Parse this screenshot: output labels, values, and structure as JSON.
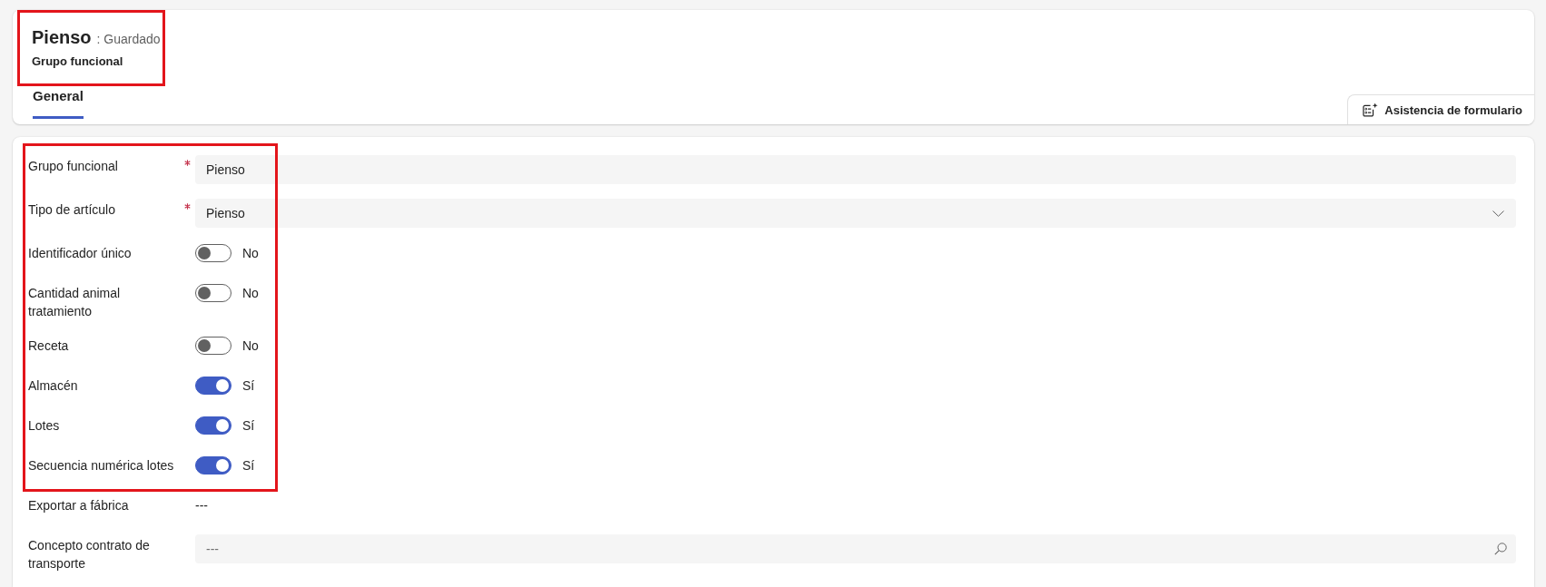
{
  "header": {
    "title": "Pienso",
    "status": ": Guardado",
    "entity": "Grupo funcional",
    "highlighted": true
  },
  "tabs": [
    {
      "label": "General",
      "selected": true
    }
  ],
  "form_assist_button": {
    "label": "Asistencia de formulario"
  },
  "field_groups": [
    {
      "highlighted": true,
      "fields": [
        {
          "kind": "text",
          "label": "Grupo funcional",
          "required": true,
          "value": "Pienso"
        },
        {
          "kind": "dropdown",
          "label": "Tipo de artículo",
          "required": true,
          "value": "Pienso"
        },
        {
          "kind": "toggle",
          "label": "Identificador único",
          "required": false,
          "on": false,
          "value": "No"
        },
        {
          "kind": "toggle",
          "label": "Cantidad animal tratamiento",
          "required": false,
          "on": false,
          "value": "No"
        },
        {
          "kind": "toggle",
          "label": "Receta",
          "required": false,
          "on": false,
          "value": "No"
        },
        {
          "kind": "toggle",
          "label": "Almacén",
          "required": false,
          "on": true,
          "value": "Sí"
        },
        {
          "kind": "toggle",
          "label": "Lotes",
          "required": false,
          "on": true,
          "value": "Sí"
        },
        {
          "kind": "toggle",
          "label": "Secuencia numérica lotes",
          "required": false,
          "on": true,
          "value": "Sí"
        }
      ]
    },
    {
      "highlighted": false,
      "fields": [
        {
          "kind": "readonly",
          "label": "Exportar a fábrica",
          "required": false,
          "value": "---"
        },
        {
          "kind": "lookup",
          "label": "Concepto contrato de transporte",
          "required": false,
          "placeholder": "---"
        }
      ]
    }
  ]
}
